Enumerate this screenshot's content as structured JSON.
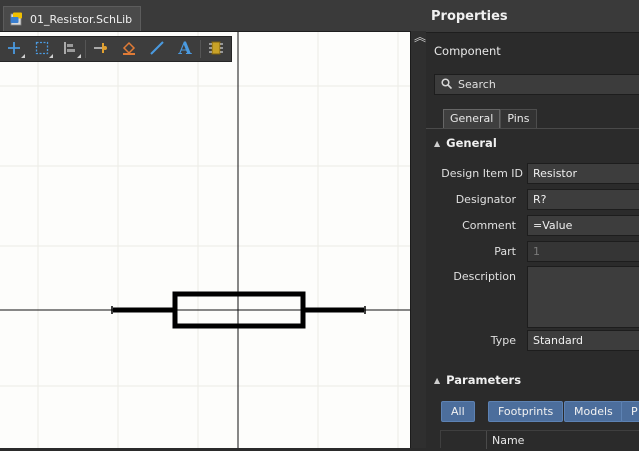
{
  "document_tab": {
    "label": "01_Resistor.SchLib"
  },
  "toolbar": {
    "items": [
      "add-icon",
      "select-rect-icon",
      "align-icon",
      "pin-icon",
      "fill-icon",
      "line-icon",
      "text-icon",
      "component-icon"
    ],
    "accent_orange": "#e07b36",
    "accent_blue": "#4a9ae0"
  },
  "properties": {
    "title": "Properties",
    "kind": "Component",
    "search_placeholder": "Search",
    "tabs": [
      "General",
      "Pins"
    ],
    "general": {
      "section_title": "General",
      "design_item_id_label": "Design Item ID",
      "design_item_id": "Resistor",
      "designator_label": "Designator",
      "designator": "R?",
      "comment_label": "Comment",
      "comment": "=Value",
      "part_label": "Part",
      "part": "1",
      "description_label": "Description",
      "description": "",
      "type_label": "Type",
      "type": "Standard"
    },
    "parameters": {
      "section_title": "Parameters",
      "filters": [
        "All",
        "Footprints",
        "Models",
        "P"
      ],
      "name_header": "Name"
    }
  },
  "colors": {
    "canvas_bg": "#fdfdfb",
    "panel_bg": "#2b2b2b",
    "button_blue": "#4c6e9c"
  }
}
